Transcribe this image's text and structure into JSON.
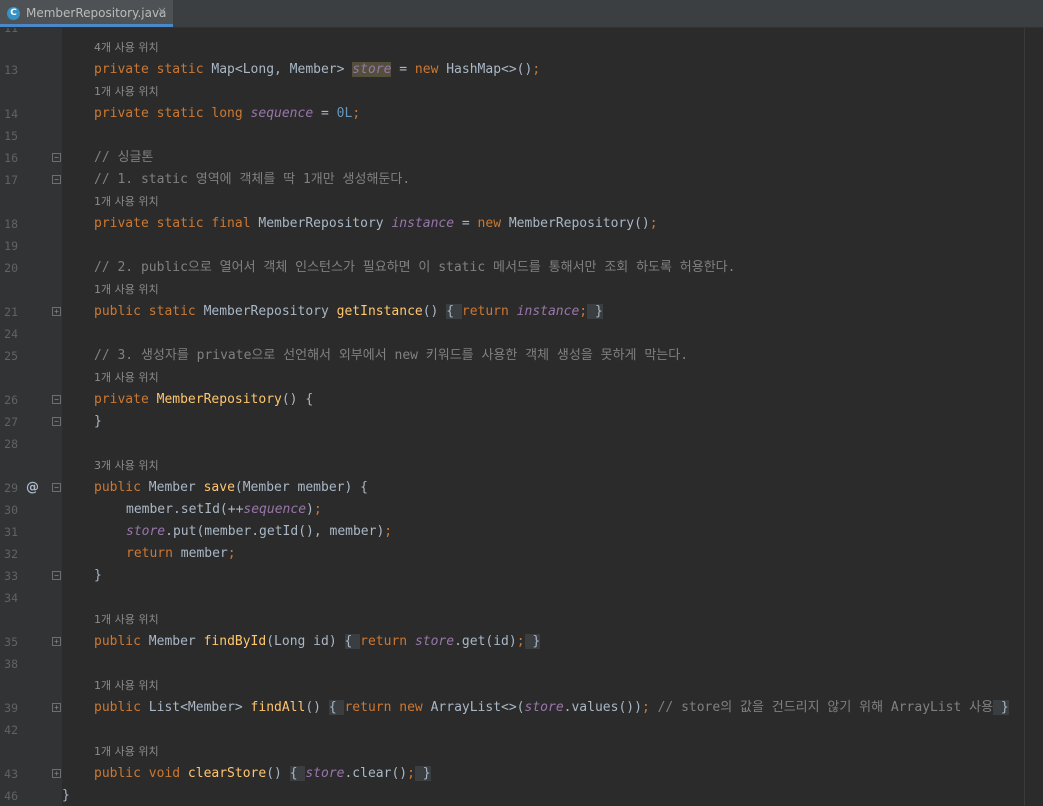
{
  "tab": {
    "file_name": "MemberRepository.java",
    "icon_letter": "C",
    "close_glyph": "×"
  },
  "usages": {
    "u4": "4개 사용 위치",
    "u1": "1개 사용 위치",
    "u3": "3개 사용 위치"
  },
  "line_numbers": {
    "l11": "11",
    "l13": "13",
    "l14": "14",
    "l15": "15",
    "l16": "16",
    "l17": "17",
    "l18": "18",
    "l19": "19",
    "l20": "20",
    "l21": "21",
    "l24": "24",
    "l25": "25",
    "l26": "26",
    "l27": "27",
    "l28": "28",
    "l29": "29",
    "l30": "30",
    "l31": "31",
    "l32": "32",
    "l33": "33",
    "l34": "34",
    "l35": "35",
    "l38": "38",
    "l39": "39",
    "l42": "42",
    "l43": "43",
    "l46": "46"
  },
  "code": {
    "c13": {
      "a": "private static ",
      "b": "Map<Long, Member> ",
      "c": "store",
      "d": " = ",
      "e": "new ",
      "f": "HashMap<>()",
      "g": ";"
    },
    "c14": {
      "a": "private static long ",
      "b": "sequence",
      "c": " = ",
      "d": "0L",
      "e": ";"
    },
    "c16": "// 싱글톤",
    "c17": "// 1. static 영역에 객체를 딱 1개만 생성해둔다.",
    "c18": {
      "a": "private static final ",
      "b": "MemberRepository ",
      "c": "instance",
      "d": " = ",
      "e": "new ",
      "f": "MemberRepository()",
      "g": ";"
    },
    "c20": "// 2. public으로 열어서 객체 인스턴스가 필요하면 이 static 메서드를 통해서만 조회 하도록 허용한다.",
    "c21": {
      "a": "public static ",
      "b": "MemberRepository ",
      "c": "getInstance",
      "d": "() ",
      "e": "{ ",
      "f": "return ",
      "g": "instance",
      "h": ";",
      "i": " }"
    },
    "c25": "// 3. 생성자를 private으로 선언해서 외부에서 new 키워드를 사용한 객체 생성을 못하게 막는다.",
    "c26": {
      "a": "private ",
      "b": "MemberRepository",
      "c": "() {"
    },
    "c27": "}",
    "c29": {
      "a": "public ",
      "b": "Member ",
      "c": "save",
      "d": "(Member member) {"
    },
    "c30": {
      "a": "member.setId(++",
      "b": "sequence",
      "c": ")",
      "d": ";"
    },
    "c31": {
      "a": "store",
      "b": ".put(member.getId(), member)",
      "c": ";"
    },
    "c32": {
      "a": "return ",
      "b": "member",
      "c": ";"
    },
    "c33": "}",
    "c35": {
      "a": "public ",
      "b": "Member ",
      "c": "findById",
      "d": "(Long id) ",
      "e": "{ ",
      "f": "return ",
      "g": "store",
      "h": ".get(id)",
      "i": ";",
      "j": " }"
    },
    "c39": {
      "a": "public ",
      "b": "List<Member> ",
      "c": "findAll",
      "d": "() ",
      "e": "{ ",
      "f": "return ",
      "g": "new ",
      "h": "ArrayList<>(",
      "i": "store",
      "j": ".values())",
      "k": "; ",
      "l": "// store의 값을 건드리지 않기 위해 ArrayList 사용",
      "m": " }"
    },
    "c43": {
      "a": "public void ",
      "b": "clearStore",
      "c": "() ",
      "d": "{ ",
      "e": "store",
      "f": ".clear()",
      "g": ";",
      "h": " }"
    },
    "c46": "}"
  },
  "gutter": {
    "override_marker": "@"
  },
  "colors": {
    "background": "#2b2b2b",
    "keyword": "#cc7832",
    "method": "#ffc66d",
    "static_field": "#9876aa",
    "comment": "#808080",
    "number": "#6897bb"
  }
}
